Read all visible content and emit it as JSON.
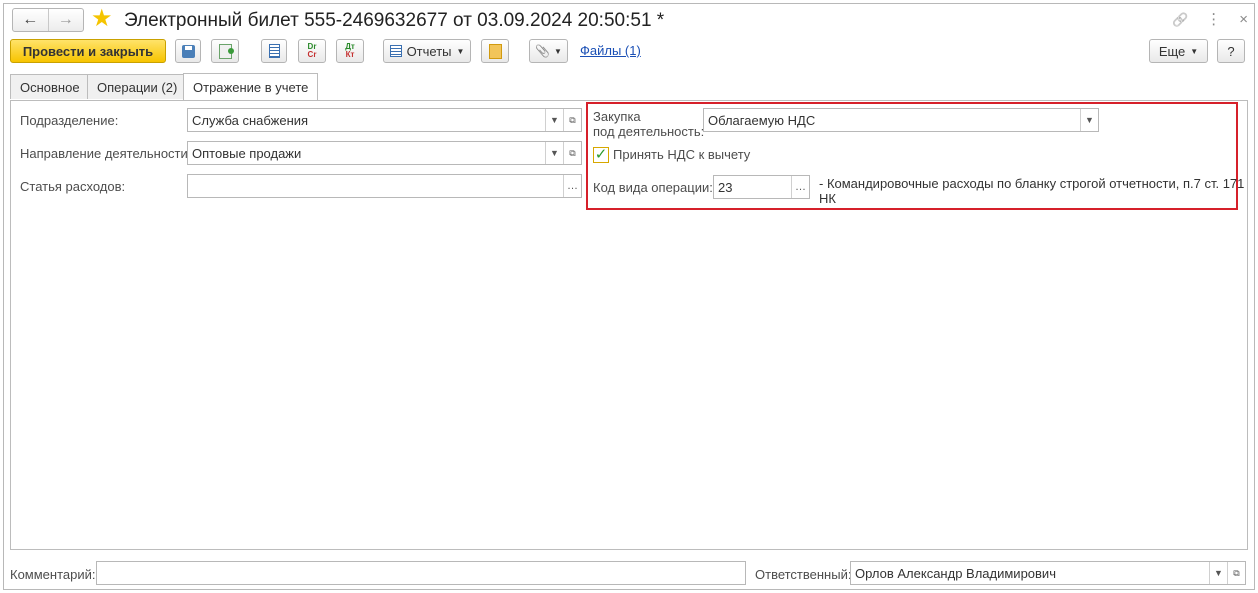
{
  "window": {
    "title": "Электронный билет 555-2469632677 от 03.09.2024 20:50:51 *",
    "nav_back": "←",
    "nav_forward": "→",
    "star": "★",
    "link_icon": "🔗",
    "more_icon": "⋮",
    "close_icon": "×"
  },
  "toolbar": {
    "post_close_label": "Провести и закрыть",
    "reports_label": "Отчеты",
    "files_label": "Файлы (1)",
    "more_label": "Еще",
    "help_label": "?",
    "dtkt_top": "Дт",
    "dtkt_bottom": "Кт",
    "dr_top": "Dr",
    "dr_bottom": "Cr",
    "paperclip": "📎"
  },
  "tabs": [
    {
      "label": "Основное"
    },
    {
      "label": "Операции (2)"
    },
    {
      "label": "Отражение в учете"
    }
  ],
  "form": {
    "department_label": "Подразделение:",
    "department_value": "Служба снабжения",
    "activity_label": "Направление деятельности:",
    "activity_value": "Оптовые продажи",
    "expense_label": "Статья расходов:",
    "expense_value": "",
    "purchase_label_1": "Закупка",
    "purchase_label_2": "под деятельность:",
    "purchase_value": "Облагаемую НДС",
    "vat_deduct_label": "Принять НДС к вычету",
    "vat_deduct_checked": true,
    "op_code_label": "Код вида операции:",
    "op_code_value": "23",
    "op_code_desc_1": "- Командировочные расходы по бланку строгой отчетности, п.7 ст. 171",
    "op_code_desc_2": "НК"
  },
  "footer": {
    "comment_label": "Комментарий:",
    "comment_value": "",
    "responsible_label": "Ответственный:",
    "responsible_value": "Орлов Александр Владимирович"
  },
  "colors": {
    "primary_button": "#f7c400",
    "highlight_border": "#d6202a",
    "link": "#1a4fb5"
  }
}
